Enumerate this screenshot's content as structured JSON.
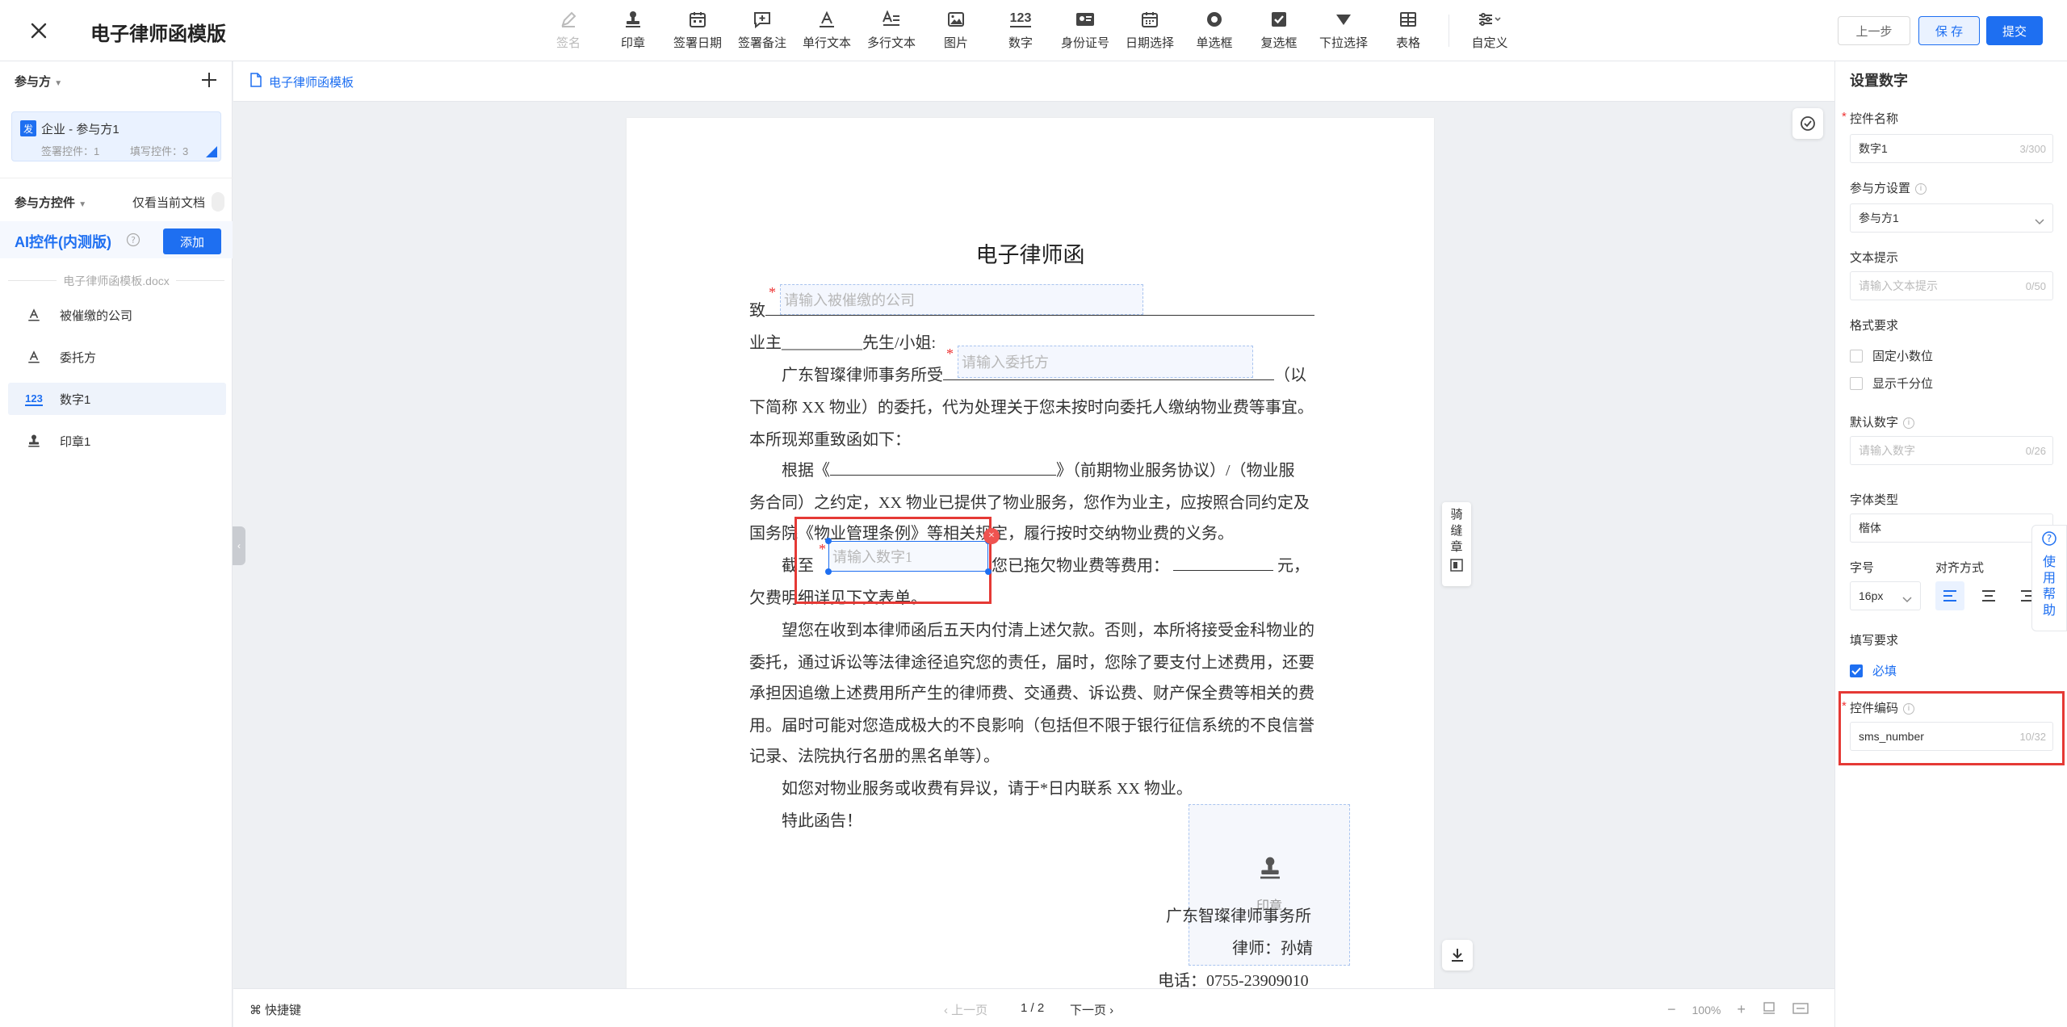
{
  "header": {
    "title": "电子律师函模版",
    "prev_label": "上一步",
    "save_label": "保 存",
    "submit_label": "提交"
  },
  "toolbar": {
    "tools": [
      {
        "label": "签名",
        "icon": "pen-icon",
        "disabled": true
      },
      {
        "label": "印章",
        "icon": "stamp-icon"
      },
      {
        "label": "签署日期",
        "icon": "calendar-icon"
      },
      {
        "label": "签署备注",
        "icon": "comment-add-icon"
      },
      {
        "label": "单行文本",
        "icon": "single-text-icon"
      },
      {
        "label": "多行文本",
        "icon": "multi-text-icon"
      },
      {
        "label": "图片",
        "icon": "image-icon"
      },
      {
        "label": "数字",
        "icon": "number-icon",
        "glyph": "123"
      },
      {
        "label": "身份证号",
        "icon": "id-card-icon"
      },
      {
        "label": "日期选择",
        "icon": "date-picker-icon"
      },
      {
        "label": "单选框",
        "icon": "radio-icon"
      },
      {
        "label": "复选框",
        "icon": "checkbox-icon"
      },
      {
        "label": "下拉选择",
        "icon": "dropdown-icon"
      },
      {
        "label": "表格",
        "icon": "table-icon"
      },
      {
        "label": "自定义",
        "icon": "sliders-icon"
      }
    ]
  },
  "left_panel": {
    "parties_header": "参与方",
    "party": {
      "badge": "发",
      "name": "企业 - 参与方1",
      "sign_ctrl": "签署控件：1",
      "fill_ctrl": "填写控件：3"
    },
    "controls_header": "参与方控件",
    "only_current_label": "仅看当前文档",
    "ai_title": "AI控件(内测版)",
    "add_label": "添加",
    "file_name": "电子律师函模板.docx",
    "items": [
      {
        "label": "被催缴的公司",
        "icon": "single-text-icon"
      },
      {
        "label": "委托方",
        "icon": "single-text-icon"
      },
      {
        "label": "数字1",
        "icon": "number-icon",
        "glyph": "123",
        "selected": true
      },
      {
        "label": "印章1",
        "icon": "stamp-icon"
      }
    ]
  },
  "breadcrumb": {
    "label": "电子律师函模板"
  },
  "document": {
    "title": "电子律师函",
    "line1_prefix": "致",
    "company_placeholder": "请输入被催缴的公司",
    "line2": "业主__________先生/小姐:",
    "line3_prefix": "广东智璨律师事务所受",
    "entrust_placeholder": "请输入委托方",
    "line3_suffix": "（以",
    "line4": "下简称 XX 物业）的委托，代为处理关于您未按时向委托人缴纳物业费等事宜。",
    "line5": "本所现郑重致函如下：",
    "line6_prefix": "根据《",
    "line6_suffix": "》（前期物业服务协议）/（物业服",
    "line7": "务合同）之约定，XX 物业已提供了物业服务，您作为业主，应按照合同约定及",
    "line8": "国务院《物业管理条例》等相关规定，履行按时交纳物业费的义务。",
    "line9_prefix": "截至",
    "number_placeholder": "请输入数字1",
    "line9_suffix": "您已拖欠物业费等费用：",
    "line9_unit": "元，",
    "line10": "欠费明细详见下文表单。",
    "line11": "望您在收到本律师函后五天内付清上述欠款。否则，本所将接受金科物业的",
    "line12": "委托，通过诉讼等法律途径追究您的责任，届时，您除了要支付上述费用，还要",
    "line13": "承担因追缴上述费用所产生的律师费、交通费、诉讼费、财产保全费等相关的费",
    "line14": "用。届时可能对您造成极大的不良影响（包括但不限于银行征信系统的不良信誉",
    "line15": "记录、法院执行名册的黑名单等）。",
    "line16": "如您对物业服务或收费有异议，请于*日内联系 XX 物业。",
    "line17": "特此函告！",
    "stamp_label": "印章",
    "sign_firm": "广东智璨律师事务所",
    "sign_lawyer": "律师：孙婧",
    "sign_phone": "电话：0755-23909010",
    "riding_seal": "骑缝章"
  },
  "bottom_bar": {
    "shortcut_label": "快捷键",
    "prev_page": "上一页",
    "page_indicator": "1 / 2",
    "next_page": "下一页",
    "zoom": "100%"
  },
  "right_panel": {
    "title": "设置数字",
    "name_label": "控件名称",
    "name_value": "数字1",
    "name_count": "3/300",
    "party_label": "参与方设置",
    "party_value": "参与方1",
    "hint_label": "文本提示",
    "hint_placeholder": "请输入文本提示",
    "hint_count": "0/50",
    "format_label": "格式要求",
    "fixed_decimal_label": "固定小数位",
    "thousands_label": "显示千分位",
    "default_label": "默认数字",
    "default_placeholder": "请输入数字",
    "default_count": "0/26",
    "font_label": "字体类型",
    "font_value": "楷体",
    "size_label": "字号",
    "size_value": "16px",
    "align_label": "对齐方式",
    "fill_label": "填写要求",
    "required_label": "必填",
    "code_label": "控件编码",
    "code_value": "sms_number",
    "code_count": "10/32",
    "help_label": "使用帮助"
  },
  "colors": {
    "accent": "#1e6ff1",
    "highlight_red": "#e53935"
  }
}
